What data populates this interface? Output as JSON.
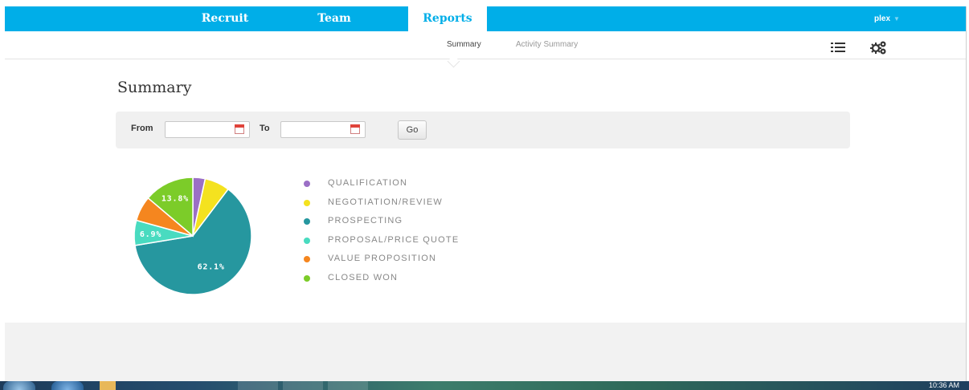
{
  "nav": {
    "items": [
      {
        "label": "Recruit",
        "active": false
      },
      {
        "label": "Team",
        "active": false
      },
      {
        "label": "Reports",
        "active": true
      }
    ],
    "user": "plex"
  },
  "subnav": {
    "items": [
      {
        "label": "Summary",
        "active": true
      },
      {
        "label": "Activity Summary",
        "active": false
      }
    ]
  },
  "page": {
    "title": "Summary"
  },
  "filter": {
    "from_label": "From",
    "to_label": "To",
    "from_value": "",
    "to_value": "",
    "go_label": "Go"
  },
  "chart_data": {
    "type": "pie",
    "categories": [
      "QUALIFICATION",
      "NEGOTIATION/REVIEW",
      "PROSPECTING",
      "PROPOSAL/PRICE QUOTE",
      "VALUE PROPOSITION",
      "CLOSED WON"
    ],
    "values": [
      3.4,
      6.9,
      62.1,
      6.9,
      6.9,
      13.8
    ],
    "colors": [
      "#9b6fc6",
      "#f4e21f",
      "#26979f",
      "#49dbc0",
      "#f5861f",
      "#7ccc29"
    ],
    "data_labels": [
      "",
      "",
      "62.1%",
      "6.9%",
      "",
      "13.8%"
    ],
    "legend_position": "right"
  },
  "taskbar": {
    "clock": "10:36 AM"
  }
}
